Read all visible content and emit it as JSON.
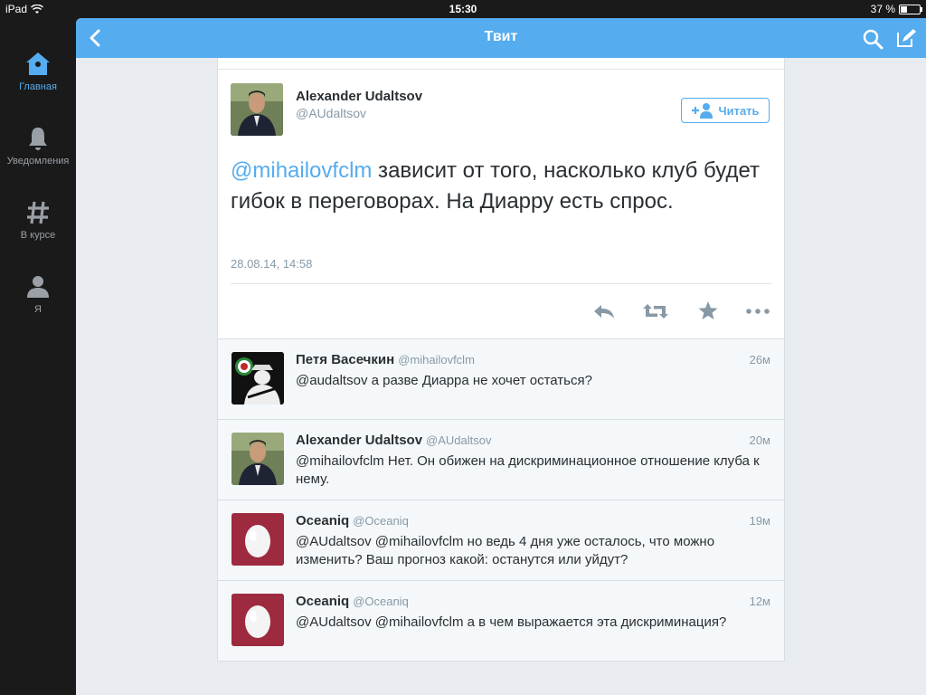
{
  "status_bar": {
    "device": "iPad",
    "time": "15:30",
    "battery": "37 %"
  },
  "sidebar": {
    "items": [
      {
        "label": "Главная",
        "icon": "home-icon",
        "active": true
      },
      {
        "label": "Уведомления",
        "icon": "bell-icon",
        "active": false
      },
      {
        "label": "В курсе",
        "icon": "hashtag-icon",
        "active": false
      },
      {
        "label": "Я",
        "icon": "person-icon",
        "active": false
      }
    ]
  },
  "header": {
    "title": "Твит"
  },
  "main_tweet": {
    "name": "Alexander Udaltsov",
    "handle": "@AUdaltsov",
    "follow_label": "Читать",
    "mention": "@mihailovfclm",
    "text": " зависит от того, насколько клуб будет гибок в переговорах. На Диарру есть спрос.",
    "timestamp": "28.08.14, 14:58"
  },
  "replies": [
    {
      "name": "Петя Васечкин",
      "handle": "@mihailovfclm",
      "time": "26м",
      "text": "@audaltsov а разве Диарра не хочет остаться?",
      "avatar": "spy"
    },
    {
      "name": "Alexander Udaltsov",
      "handle": "@AUdaltsov",
      "time": "20м",
      "text": "@mihailovfclm Нет. Он обижен на дискриминационное отношение клуба к нему.",
      "avatar": "person"
    },
    {
      "name": "Oceaniq",
      "handle": "@Oceaniq",
      "time": "19м",
      "text": "@AUdaltsov @mihailovfclm но ведь 4 дня уже осталось, что можно изменить? Ваш прогноз какой: останутся или уйдут?",
      "avatar": "egg"
    },
    {
      "name": "Oceaniq",
      "handle": "@Oceaniq",
      "time": "12м",
      "text": "@AUdaltsov @mihailovfclm а в чем выражается эта дискриминация?",
      "avatar": "egg"
    }
  ],
  "colors": {
    "accent": "#55acee",
    "sidebar_bg": "#1a1a1a",
    "page_bg": "#e8ecf0",
    "egg_bg": "#9e2a3f"
  }
}
